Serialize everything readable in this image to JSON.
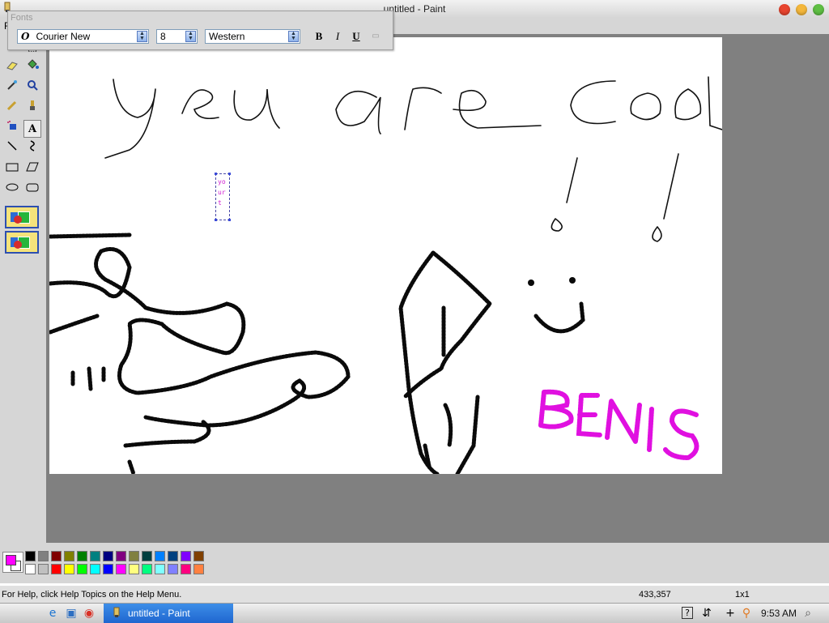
{
  "window": {
    "title": "untitled - Paint"
  },
  "menubar": {
    "first_item": "F"
  },
  "fonts_toolbar": {
    "title": "Fonts",
    "font_name": "Courier New",
    "font_size": "8",
    "script": "Western",
    "bold_label": "B",
    "italic_label": "I",
    "underline_label": "U"
  },
  "canvas": {
    "text_box_lines": [
      "yo",
      "ur",
      "t"
    ],
    "drawn_text": [
      "you are cool",
      "!!",
      "BENIS"
    ]
  },
  "colors": {
    "foreground": "#ff00ff",
    "background": "#ffffff",
    "palette": [
      "#000000",
      "#808080",
      "#800000",
      "#808000",
      "#008000",
      "#008080",
      "#000080",
      "#800080",
      "#808040",
      "#004040",
      "#0080ff",
      "#004080",
      "#8000ff",
      "#804000",
      "#ffffff",
      "#c0c0c0",
      "#ff0000",
      "#ffff00",
      "#00ff00",
      "#00ffff",
      "#0000ff",
      "#ff00ff",
      "#ffff80",
      "#00ff80",
      "#80ffff",
      "#8080ff",
      "#ff0080",
      "#ff8040"
    ]
  },
  "status": {
    "help": "For Help, click Help Topics on the Help Menu.",
    "coords": "433,357",
    "size": "1x1"
  },
  "taskbar": {
    "task_label": "untitled - Paint",
    "clock": "9:53 AM"
  }
}
